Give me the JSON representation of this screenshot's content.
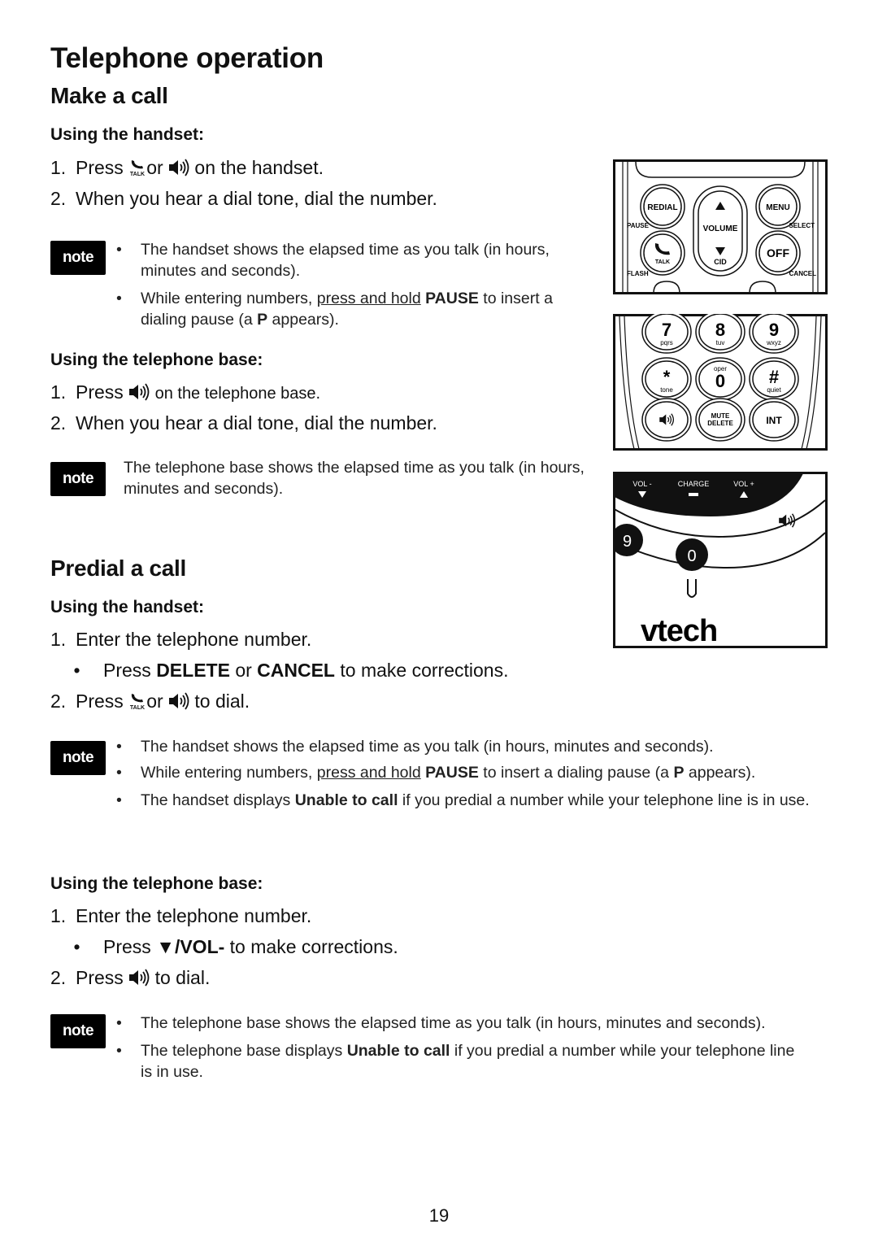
{
  "page": {
    "title": "Telephone operation",
    "page_number": "19"
  },
  "make_call": {
    "heading": "Make a call",
    "handset": {
      "heading": "Using the handset:",
      "steps": [
        {
          "num": "1.",
          "pre": "Press",
          "mid": "or",
          "post": "on the handset."
        },
        {
          "num": "2.",
          "text": "When you hear a dial tone, dial the number."
        }
      ],
      "note_label": "note",
      "notes": [
        {
          "text": "The handset shows the elapsed time as you talk (in hours, minutes and seconds)."
        },
        {
          "pre": "While entering numbers,",
          "underline": "press and hold",
          "bold": "PAUSE",
          "mid": "to insert a dialing pause (a",
          "bold2": "P",
          "post": "appears)."
        }
      ]
    },
    "base": {
      "heading": "Using the telephone base:",
      "steps": [
        {
          "num": "1.",
          "pre": "Press",
          "post": "on the telephone base."
        },
        {
          "num": "2.",
          "text": "When you hear a dial tone, dial the number."
        }
      ],
      "note_label": "note",
      "note": "The telephone base shows the elapsed time as you talk (in hours, minutes and seconds)."
    }
  },
  "predial": {
    "heading": "Predial a call",
    "handset": {
      "heading": "Using the handset:",
      "step1": {
        "num": "1.",
        "text": "Enter the telephone number."
      },
      "sub": {
        "pre": "Press",
        "bold1": "DELETE",
        "mid": "or",
        "bold2": "CANCEL",
        "post": "to make corrections."
      },
      "step2": {
        "num": "2.",
        "pre": "Press",
        "mid": "or",
        "post": "to dial."
      },
      "note_label": "note",
      "notes": [
        {
          "text": "The handset shows the elapsed time as you talk (in hours, minutes and seconds)."
        },
        {
          "pre": "While entering numbers,",
          "underline": "press and hold",
          "bold": "PAUSE",
          "mid": "to insert a dialing pause (a",
          "bold2": "P",
          "post": "appears)."
        },
        {
          "pre": "The handset displays",
          "bold": "Unable to call",
          "post": "if you predial a number while your telephone line is in use."
        }
      ]
    },
    "base": {
      "heading": "Using the telephone base:",
      "step1": {
        "num": "1.",
        "text": "Enter the telephone number."
      },
      "sub": {
        "pre": "Press",
        "bold": "▼/VOL-",
        "post": "to make corrections."
      },
      "step2": {
        "num": "2.",
        "pre": "Press",
        "post": "to dial."
      },
      "note_label": "note",
      "notes": [
        {
          "text": "The telephone base shows the elapsed time as you talk (in hours, minutes and seconds)."
        },
        {
          "pre": "The telephone base displays",
          "bold": "Unable to call",
          "post": "if you predial a number while your telephone line is in use."
        }
      ]
    }
  },
  "icons": {
    "talk_label": "TALK",
    "bullet": "•"
  },
  "illustrations": {
    "handset_top": {
      "redial": "REDIAL",
      "pause": "PAUSE",
      "volume": "VOLUME",
      "cid": "CID",
      "menu": "MENU",
      "select": "SELECT",
      "talk": "TALK",
      "flash": "FLASH",
      "off": "OFF",
      "cancel": "CANCEL"
    },
    "handset_keypad": {
      "keys": [
        {
          "main": "7",
          "sub": "pqrs"
        },
        {
          "main": "8",
          "sub": "tuv"
        },
        {
          "main": "9",
          "sub": "wxyz"
        },
        {
          "main": "*",
          "sub": "tone"
        },
        {
          "main": "0",
          "sub": "oper"
        },
        {
          "main": "#",
          "sub": "quiet"
        }
      ],
      "mute_line1": "MUTE",
      "mute_line2": "DELETE",
      "int": "INT"
    },
    "base": {
      "vol_minus": "VOL -",
      "charge": "CHARGE",
      "vol_plus": "VOL +",
      "key9": "9",
      "key0": "0",
      "brand": "vtech"
    }
  }
}
